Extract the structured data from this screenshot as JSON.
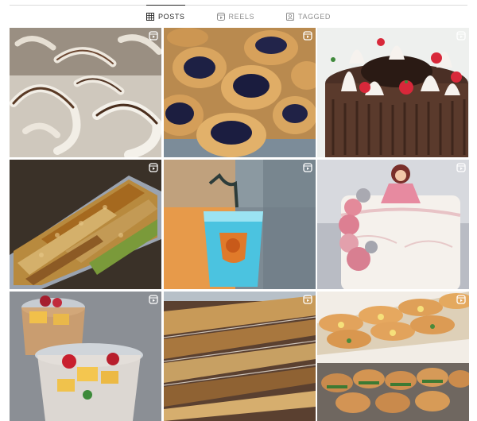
{
  "profile_tabs": [
    {
      "label": "POSTS",
      "icon": "grid-icon",
      "active": true
    },
    {
      "label": "REELS",
      "icon": "reels-icon",
      "active": false
    },
    {
      "label": "TAGGED",
      "icon": "tagged-icon",
      "active": false
    }
  ],
  "posts": [
    {
      "subject": "coconut-chips",
      "badge": "reel-icon"
    },
    {
      "subject": "blueberry-danish",
      "badge": "reel-icon"
    },
    {
      "subject": "chocolate-cake",
      "badge": "reel-icon"
    },
    {
      "subject": "nut-platter",
      "badge": "reel-icon"
    },
    {
      "subject": "blue-drink",
      "badge": "reel-icon"
    },
    {
      "subject": "doll-cake",
      "badge": "reel-icon"
    },
    {
      "subject": "fruit-cups",
      "badge": "reel-icon"
    },
    {
      "subject": "pastry-display",
      "badge": "reel-icon"
    },
    {
      "subject": "sandwich-rolls",
      "badge": "reel-icon"
    }
  ],
  "colors": {
    "active_tab": "#262626",
    "inactive_tab": "#8e8e8e",
    "divider": "#dbdbdb"
  }
}
